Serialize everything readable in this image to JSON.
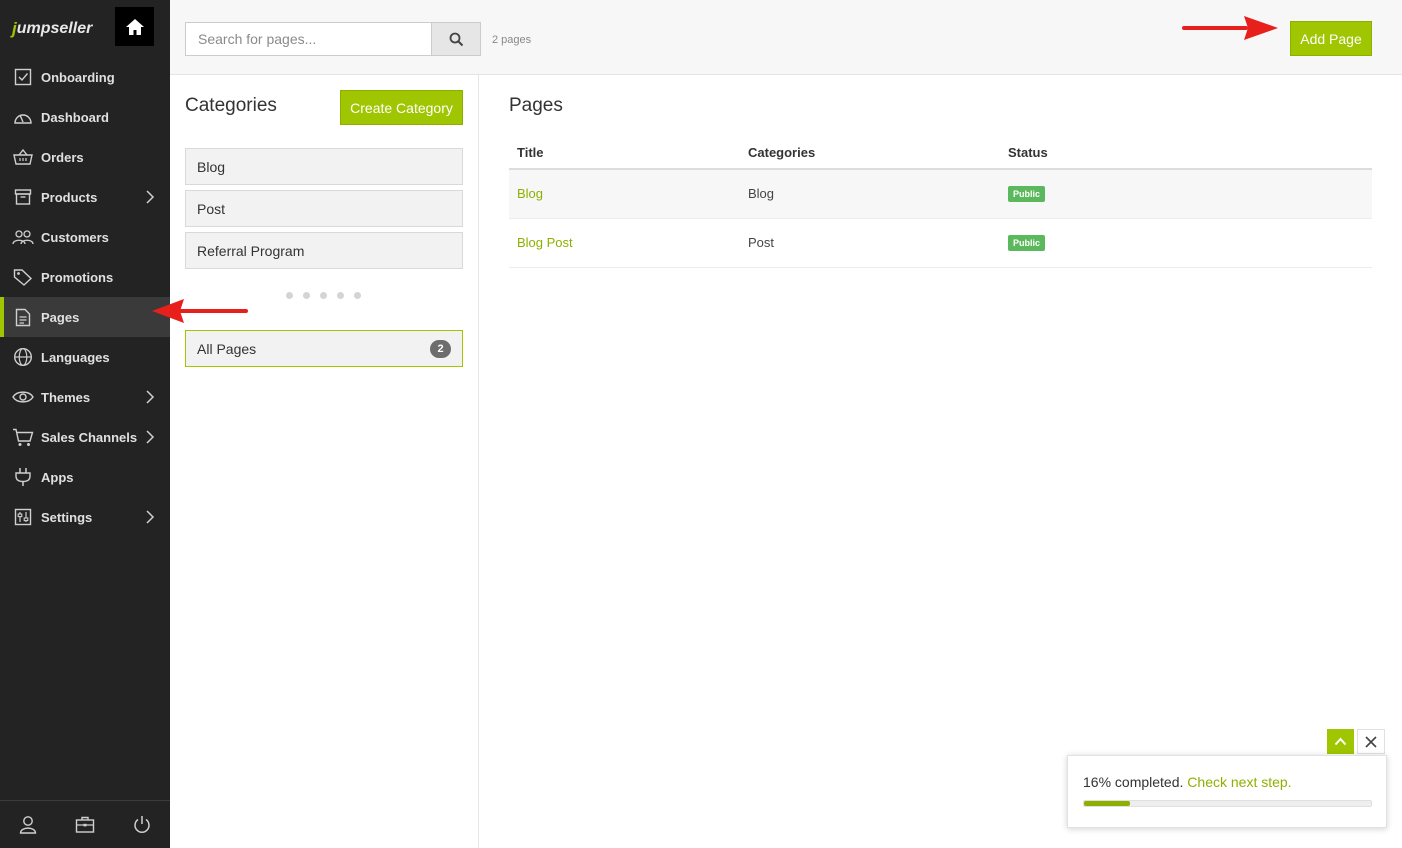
{
  "brand": {
    "logo_initial": "j",
    "logo_rest": "umpseller",
    "accent": "#9fc600"
  },
  "sidebar": {
    "items": [
      {
        "label": "Onboarding",
        "icon": "checkbox-icon",
        "chevron": false,
        "active": false
      },
      {
        "label": "Dashboard",
        "icon": "gauge-icon",
        "chevron": false,
        "active": false
      },
      {
        "label": "Orders",
        "icon": "basket-icon",
        "chevron": false,
        "active": false
      },
      {
        "label": "Products",
        "icon": "archive-box-icon",
        "chevron": true,
        "active": false
      },
      {
        "label": "Customers",
        "icon": "users-icon",
        "chevron": false,
        "active": false
      },
      {
        "label": "Promotions",
        "icon": "tag-icon",
        "chevron": false,
        "active": false
      },
      {
        "label": "Pages",
        "icon": "document-icon",
        "chevron": false,
        "active": true
      },
      {
        "label": "Languages",
        "icon": "globe-icon",
        "chevron": false,
        "active": false
      },
      {
        "label": "Themes",
        "icon": "eye-icon",
        "chevron": true,
        "active": false
      },
      {
        "label": "Sales Channels",
        "icon": "cart-icon",
        "chevron": true,
        "active": false
      },
      {
        "label": "Apps",
        "icon": "plug-icon",
        "chevron": false,
        "active": false
      },
      {
        "label": "Settings",
        "icon": "sliders-icon",
        "chevron": true,
        "active": false
      }
    ],
    "footer_icons": [
      "user-icon",
      "briefcase-icon",
      "power-icon"
    ]
  },
  "topbar": {
    "search_placeholder": "Search for pages...",
    "page_count": "2 pages",
    "add_page_label": "Add Page"
  },
  "categories": {
    "title": "Categories",
    "create_label": "Create Category",
    "items": [
      "Blog",
      "Post",
      "Referral Program"
    ],
    "all_pages_label": "All Pages",
    "all_pages_count": "2"
  },
  "pages": {
    "title": "Pages",
    "columns": [
      "Title",
      "Categories",
      "Status"
    ],
    "rows": [
      {
        "title": "Blog",
        "category": "Blog",
        "status": "Public"
      },
      {
        "title": "Blog Post",
        "category": "Post",
        "status": "Public"
      }
    ]
  },
  "progress": {
    "percent_text": "16% completed.",
    "link_text": "Check next step.",
    "value": 0.16
  }
}
